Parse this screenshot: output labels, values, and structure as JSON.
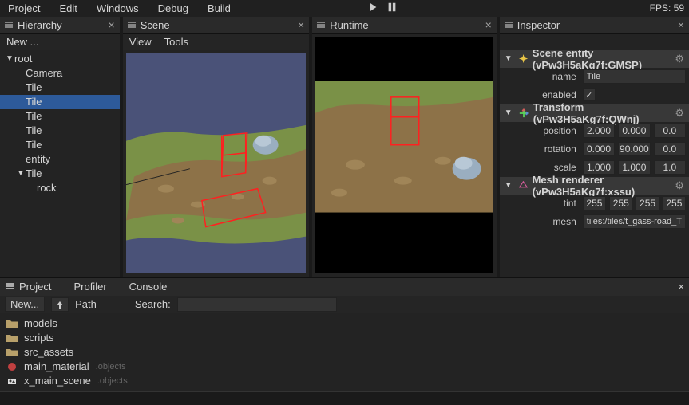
{
  "menubar": {
    "items": [
      "Project",
      "Edit",
      "Windows",
      "Debug",
      "Build"
    ],
    "fps": "FPS: 59"
  },
  "panels": {
    "hierarchy": {
      "title": "Hierarchy",
      "new_label": "New ...",
      "tree": [
        {
          "label": "root",
          "depth": 0,
          "arrow": "▼",
          "selected": false
        },
        {
          "label": "Camera",
          "depth": 1,
          "arrow": "",
          "selected": false
        },
        {
          "label": "Tile",
          "depth": 1,
          "arrow": "",
          "selected": false
        },
        {
          "label": "Tile",
          "depth": 1,
          "arrow": "",
          "selected": true
        },
        {
          "label": "Tile",
          "depth": 1,
          "arrow": "",
          "selected": false
        },
        {
          "label": "Tile",
          "depth": 1,
          "arrow": "",
          "selected": false
        },
        {
          "label": "Tile",
          "depth": 1,
          "arrow": "",
          "selected": false
        },
        {
          "label": "entity",
          "depth": 1,
          "arrow": "",
          "selected": false
        },
        {
          "label": "Tile",
          "depth": 1,
          "arrow": "▼",
          "selected": false
        },
        {
          "label": "rock",
          "depth": 2,
          "arrow": "",
          "selected": false
        }
      ]
    },
    "scene": {
      "title": "Scene",
      "view_label": "View",
      "tools_label": "Tools"
    },
    "runtime": {
      "title": "Runtime"
    },
    "inspector": {
      "title": "Inspector",
      "entity": {
        "header": "Scene entity (vPw3H5aKg7f:GMSP)",
        "name_label": "name",
        "name_value": "Tile",
        "enabled_label": "enabled",
        "enabled_value": true
      },
      "transform": {
        "header": "Transform (vPw3H5aKg7f:QWnj)",
        "position_label": "position",
        "position": [
          "2.000",
          "0.000",
          "0.0"
        ],
        "rotation_label": "rotation",
        "rotation": [
          "0.000",
          "90.000",
          "0.0"
        ],
        "scale_label": "scale",
        "scale": [
          "1.000",
          "1.000",
          "1.0"
        ]
      },
      "meshrenderer": {
        "header": "Mesh renderer (vPw3H5aKg7f:xssu)",
        "tint_label": "tint",
        "tint": [
          "255",
          "255",
          "255",
          "255"
        ],
        "mesh_label": "mesh",
        "mesh_value": "tiles:/tiles/t_gass-road_T"
      }
    }
  },
  "project": {
    "tabs": [
      "Project",
      "Profiler",
      "Console"
    ],
    "new_label": "New...",
    "path_label": "Path",
    "search_label": "Search:",
    "files": [
      {
        "name": "models",
        "type": "folder"
      },
      {
        "name": "scripts",
        "type": "folder"
      },
      {
        "name": "src_assets",
        "type": "folder"
      },
      {
        "name": "main_material",
        "type": "material",
        "suffix": ".objects"
      },
      {
        "name": "x_main_scene",
        "type": "scene",
        "suffix": ".objects"
      }
    ]
  }
}
